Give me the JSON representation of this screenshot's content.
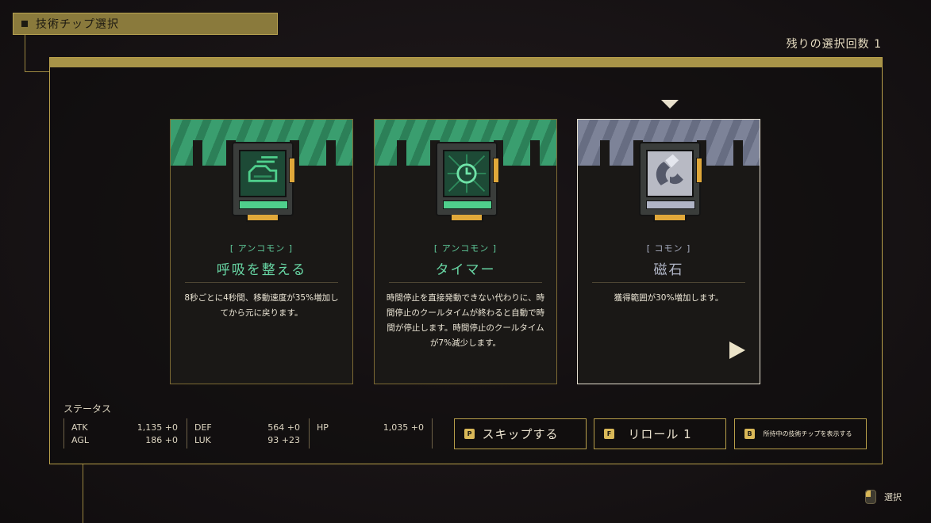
{
  "header": {
    "title": "技術チップ選択"
  },
  "remaining": "残りの選択回数 1",
  "cards": [
    {
      "rarity": "[ アンコモン ]",
      "name": "呼吸を整える",
      "desc": "8秒ごとに4秒間、移動速度が35%増加してから元に戻ります。",
      "icon": "breath-icon",
      "theme": "green"
    },
    {
      "rarity": "[ アンコモン ]",
      "name": "タイマー",
      "desc": "時間停止を直接発動できない代わりに、時間停止のクールタイムが終わると自動で時間が停止します。時間停止のクールタイムが7%減少します。",
      "icon": "timer-icon",
      "theme": "green"
    },
    {
      "rarity": "[ コモン ]",
      "name": "磁石",
      "desc": "獲得範囲が30%増加します。",
      "icon": "magnet-icon",
      "theme": "gray",
      "selected": true
    }
  ],
  "status": {
    "title": "ステータス",
    "atk": {
      "label": "ATK",
      "value": "1,135 +0"
    },
    "agl": {
      "label": "AGL",
      "value": "186 +0"
    },
    "def": {
      "label": "DEF",
      "value": "564 +0"
    },
    "luk": {
      "label": "LUK",
      "value": "93 +23"
    },
    "hp": {
      "label": "HP",
      "value": "1,035 +0"
    }
  },
  "buttons": {
    "skip": {
      "key": "P",
      "label": "スキップする"
    },
    "reroll": {
      "key": "F",
      "label": "リロール 1"
    },
    "show": {
      "key": "B",
      "label": "所持中の技術チップを表示する"
    }
  },
  "hint": {
    "label": "選択",
    "icon": "mouse-left-icon"
  },
  "colors": {
    "accent": "#b89f4a",
    "uncommon": "#3a9e6f",
    "common": "#7d8398"
  }
}
